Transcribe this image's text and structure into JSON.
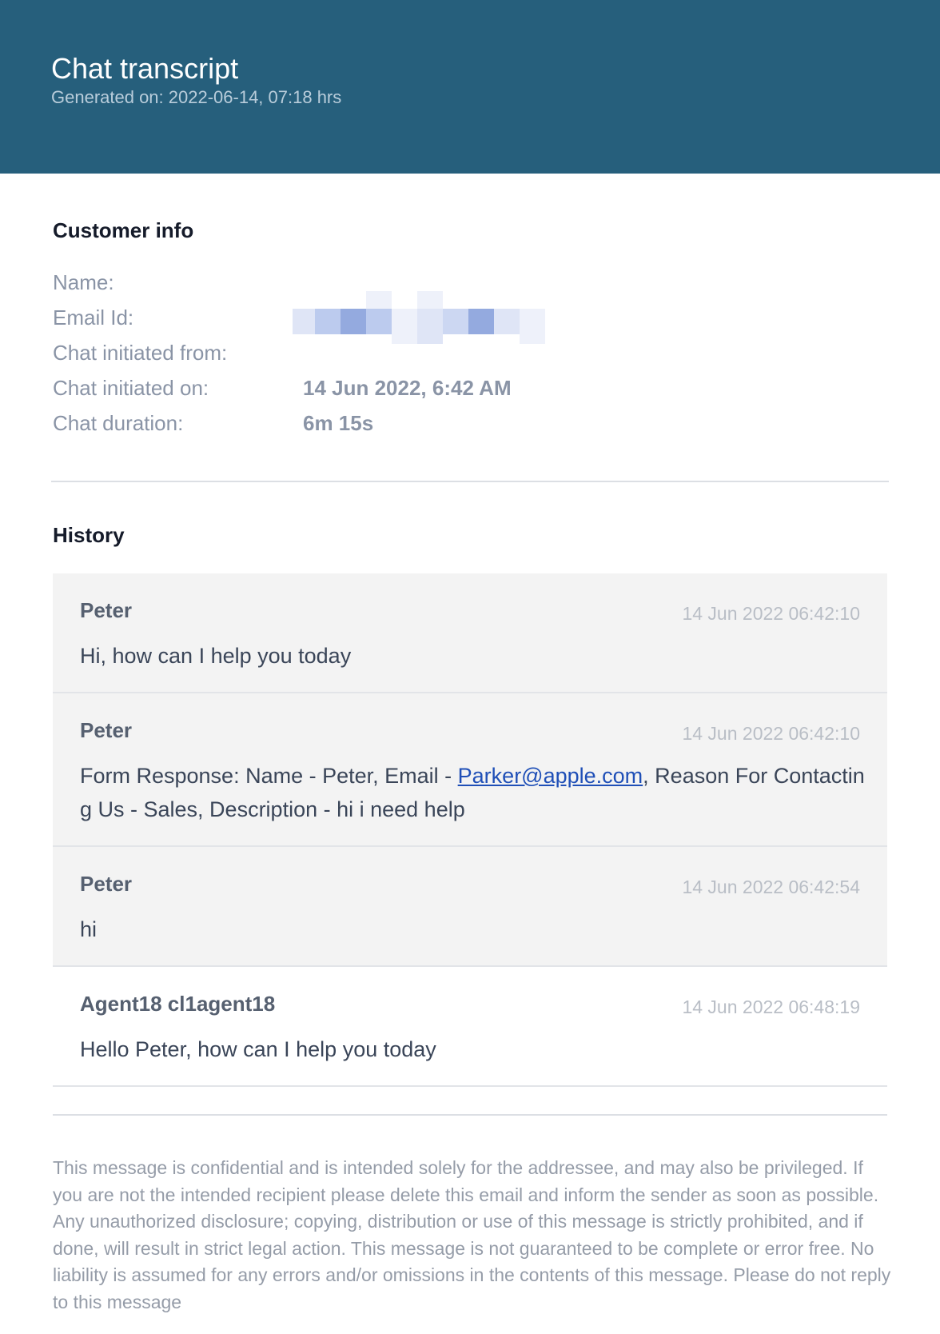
{
  "header": {
    "title": "Chat transcript",
    "generated": "Generated on: 2022-06-14, 07:18 hrs",
    "bg_color": "#265f7c"
  },
  "customer_info": {
    "title": "Customer info",
    "fields": [
      {
        "label": "Name:",
        "value": ""
      },
      {
        "label": "Email Id:",
        "value": ""
      },
      {
        "label": "Chat initiated from:",
        "value": ""
      },
      {
        "label": "Chat initiated on:",
        "value": "14 Jun 2022, 6:42 AM"
      },
      {
        "label": "Chat duration:",
        "value": "6m 15s"
      }
    ]
  },
  "history": {
    "title": "History",
    "messages": [
      {
        "author": "Peter",
        "time": "14 Jun 2022 06:42:10",
        "text": "Hi, how can I help you today",
        "bg": "grey"
      },
      {
        "author": "Peter",
        "time": "14 Jun 2022 06:42:10",
        "text_before": "Form Response: Name - Peter, Email - ",
        "link": "Parker@apple.com",
        "text_after": ", Reason For Contacting Us - Sales, Description - hi i need help",
        "bg": "grey"
      },
      {
        "author": "Peter",
        "time": "14 Jun 2022 06:42:54",
        "text": "hi",
        "bg": "grey"
      },
      {
        "author": "Agent18 cl1agent18",
        "time": "14 Jun 2022 06:48:19",
        "text": "Hello Peter, how can I help you today",
        "bg": "white"
      }
    ]
  },
  "footer": {
    "disclaimer": "This message is confidential and is intended solely for the addressee, and may also be privileged. If you are not the intended recipient please delete this email and inform the sender as soon as possible. Any unauthorized disclosure; copying, distribution or use of this message is strictly prohibited, and if done, will result in strict legal action. This message is not guaranteed to be complete or error free. No liability is assumed for any errors and/or omissions in the contents of this message. Please do not reply to this message"
  }
}
